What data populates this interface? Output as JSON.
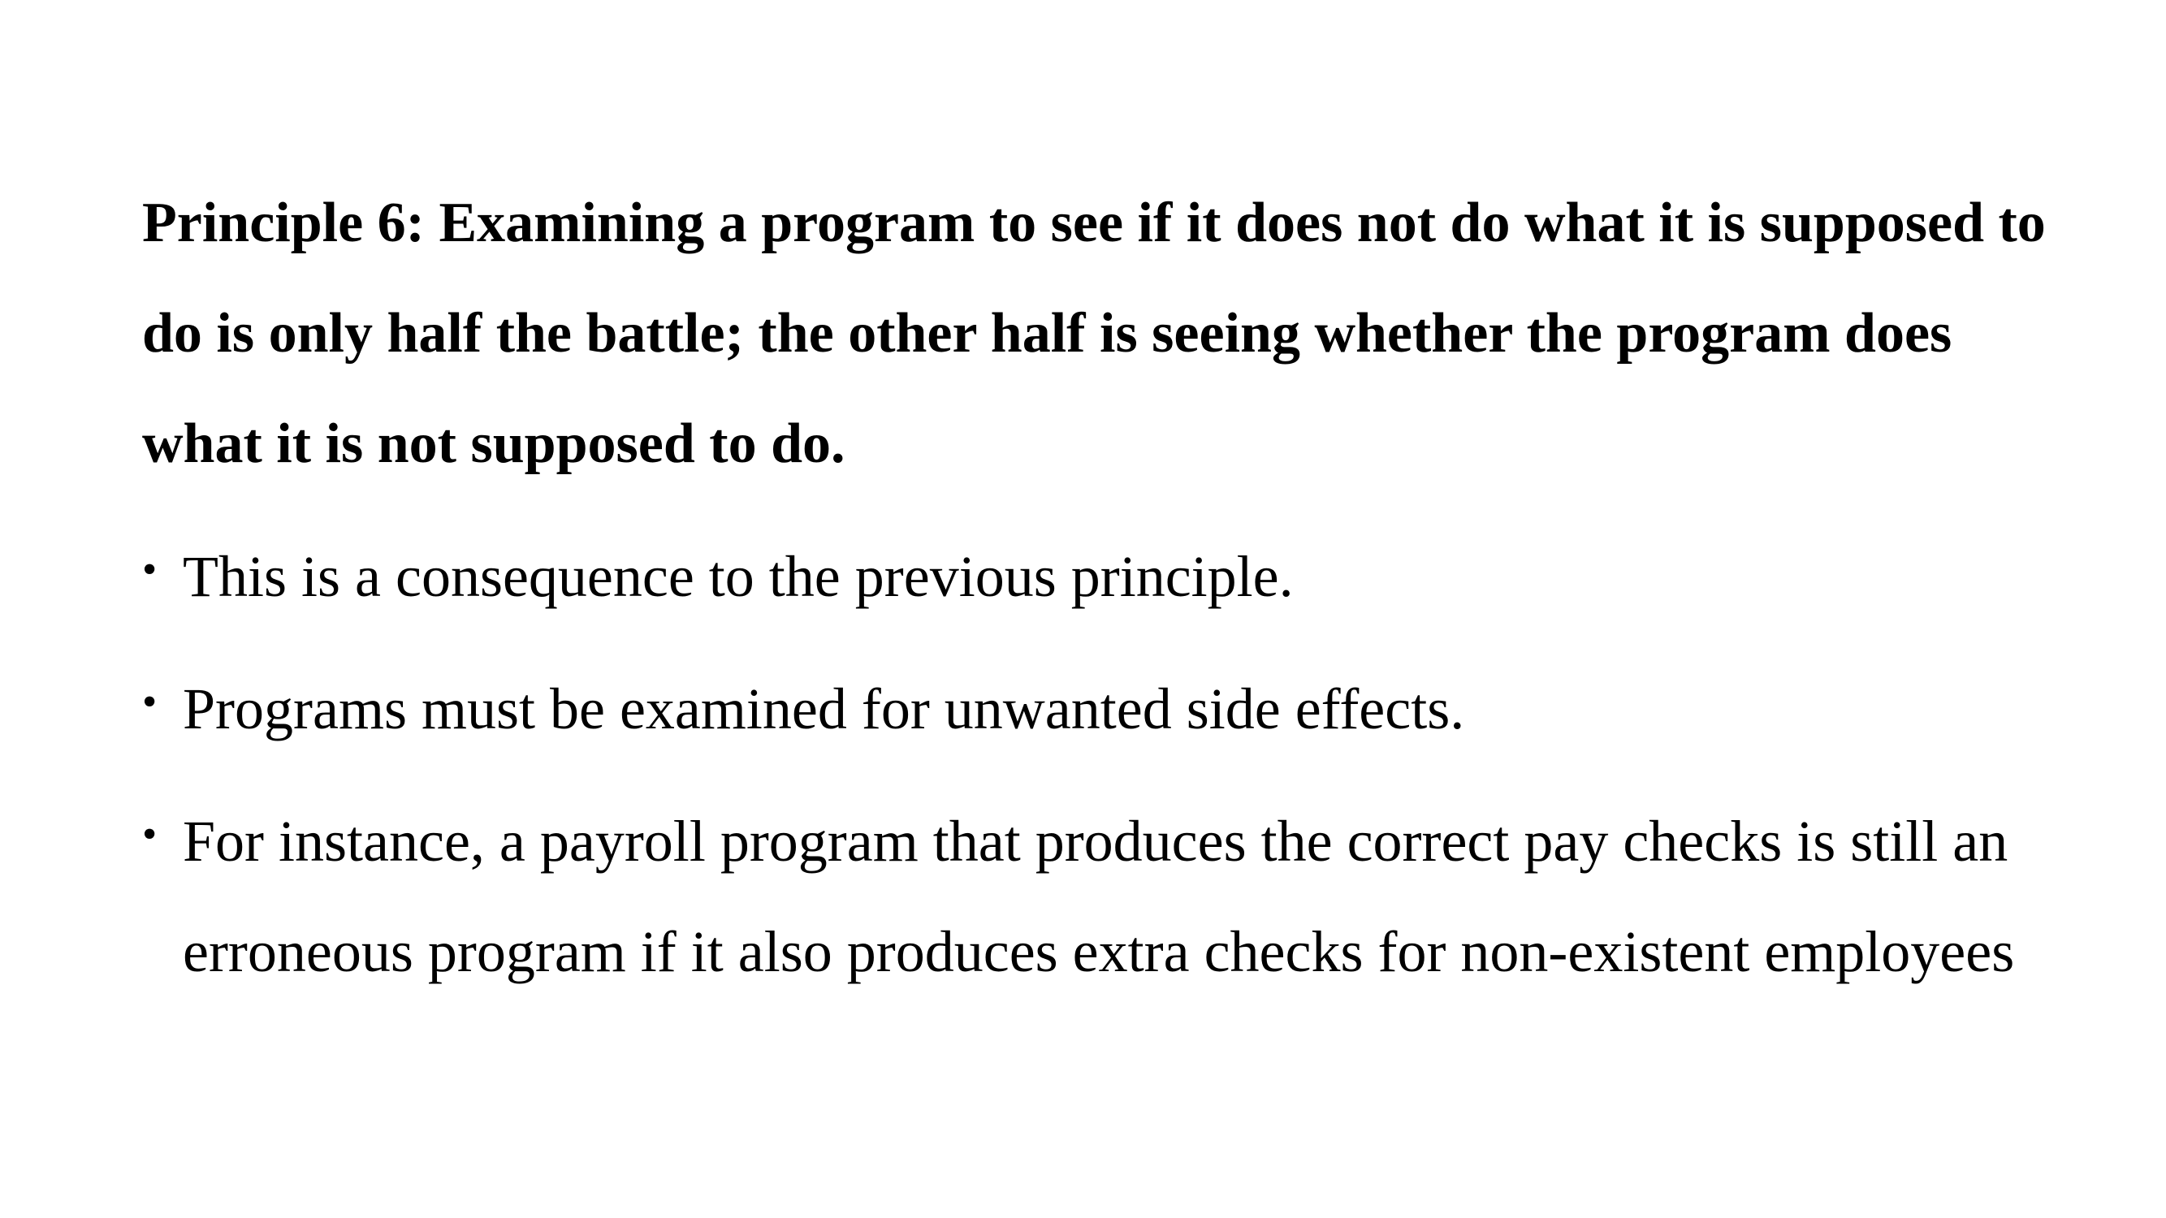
{
  "slide": {
    "heading": "Principle 6: Examining a program to see if it does not do what it is supposed to do is only half the battle; the other half is seeing whether the program does what it is not supposed to do.",
    "bullet_glyph": "•",
    "bullets": [
      "This is a consequence to the previous principle.",
      "Programs must be examined for unwanted side effects.",
      "For instance, a payroll program that produces the correct pay checks is still an erroneous program if it also produces extra checks for non-existent employees"
    ]
  }
}
